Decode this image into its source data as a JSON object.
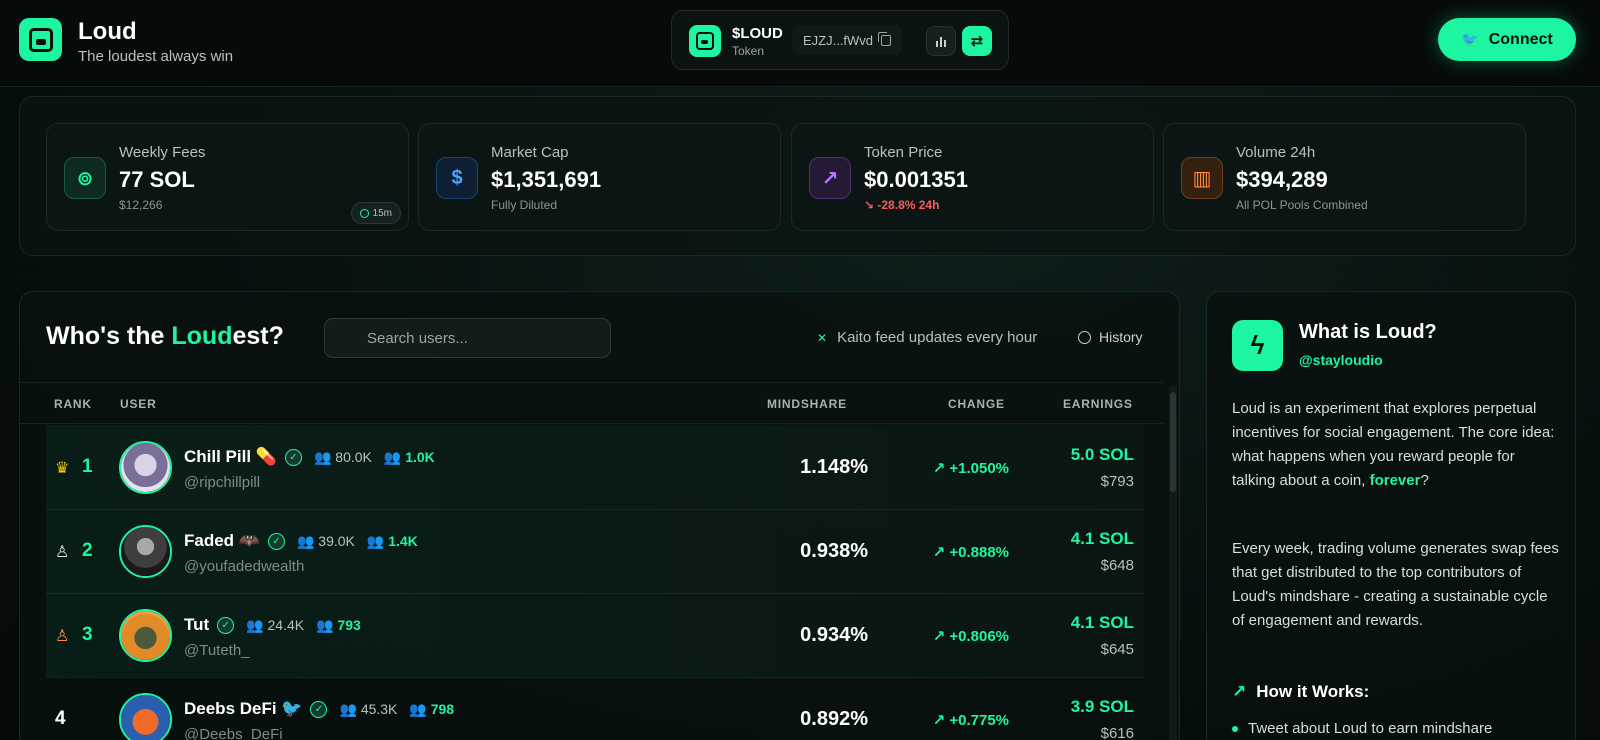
{
  "header": {
    "brand_name": "Loud",
    "tagline": "The loudest always win",
    "token": {
      "symbol": "$LOUD",
      "label": "Token",
      "address": "EJZJ...fWvd"
    },
    "connect_label": "Connect"
  },
  "stats": [
    {
      "label": "Weekly Fees",
      "value": "77 SOL",
      "sub": "$12,266",
      "badge": "15m",
      "icon": "coins-icon",
      "color": "#1ef5a0"
    },
    {
      "label": "Market Cap",
      "value": "$1,351,691",
      "sub": "Fully Diluted",
      "icon": "dollar-icon",
      "color": "#4aa3ff"
    },
    {
      "label": "Token Price",
      "value": "$0.001351",
      "sub": "-28.8% 24h",
      "icon": "trend-up-icon",
      "color": "#b57bff"
    },
    {
      "label": "Volume 24h",
      "value": "$394,289",
      "sub": "All POL Pools Combined",
      "icon": "bar-chart-icon",
      "color": "#ff8a3d"
    }
  ],
  "board": {
    "title_pre": "Who's the ",
    "title_accent": "Loud",
    "title_post": "est?",
    "search_placeholder": "Search users...",
    "kaito": "Kaito feed updates every hour",
    "history": "History",
    "columns": {
      "rank": "RANK",
      "user": "USER",
      "mindshare": "MINDSHARE",
      "change": "CHANGE",
      "earnings": "EARNINGS"
    },
    "rows": [
      {
        "rank": "1",
        "name": "Chill Pill 💊",
        "followers": "80.0K",
        "mutuals": "1.0K",
        "handle": "@ripchillpill",
        "mindshare": "1.148%",
        "change": "+1.050%",
        "earn_sol": "5.0 SOL",
        "earn_usd": "$793"
      },
      {
        "rank": "2",
        "name": "Faded 🦇",
        "followers": "39.0K",
        "mutuals": "1.4K",
        "handle": "@youfadedwealth",
        "mindshare": "0.938%",
        "change": "+0.888%",
        "earn_sol": "4.1 SOL",
        "earn_usd": "$648"
      },
      {
        "rank": "3",
        "name": "Tut",
        "followers": "24.4K",
        "mutuals": "793",
        "handle": "@Tuteth_",
        "mindshare": "0.934%",
        "change": "+0.806%",
        "earn_sol": "4.1 SOL",
        "earn_usd": "$645"
      },
      {
        "rank": "4",
        "name": "Deebs DeFi 🐦",
        "followers": "45.3K",
        "mutuals": "798",
        "handle": "@Deebs_DeFi",
        "mindshare": "0.892%",
        "change": "+0.775%",
        "earn_sol": "3.9 SOL",
        "earn_usd": "$616"
      }
    ]
  },
  "side": {
    "title": "What is Loud?",
    "handle": "@stayloudio",
    "p1_main": "Loud is an experiment that explores perpetual incentives for social engagement. The core idea: what happens when you reward people for talking about a coin, ",
    "p1_accent": "forever",
    "p1_end": "?",
    "p2": "Every week, trading volume generates swap fees that get distributed to the top contributors of Loud's mindshare - creating a sustainable cycle of engagement and rewards.",
    "how_title": "How it Works:",
    "bullet1": "Tweet about Loud to earn mindshare"
  }
}
